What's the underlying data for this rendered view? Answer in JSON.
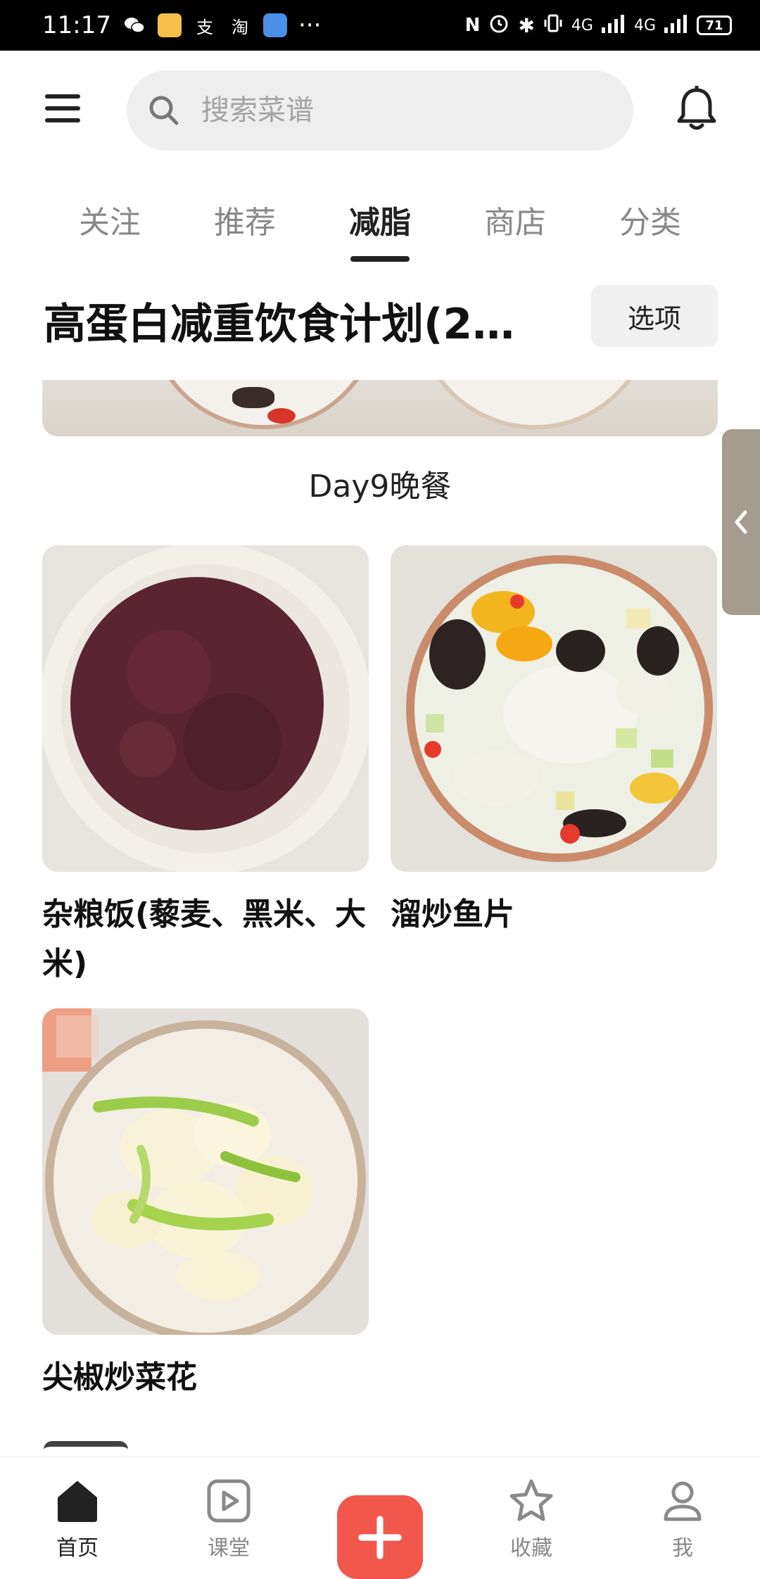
{
  "status_bar": {
    "time": "11:17",
    "alipay_glyph": "支",
    "taobao_glyph": "淘",
    "more_glyph": "···",
    "network_1": "4G",
    "network_2": "4G",
    "battery": "71"
  },
  "search": {
    "placeholder": "搜索菜谱"
  },
  "tabs": [
    {
      "label": "关注"
    },
    {
      "label": "推荐"
    },
    {
      "label": "减脂"
    },
    {
      "label": "商店"
    },
    {
      "label": "分类"
    }
  ],
  "active_tab": "减脂",
  "plan": {
    "title": "高蛋白减重饮食计划(2…",
    "options_label": "选项"
  },
  "section": {
    "title": "Day9晚餐"
  },
  "recipes": [
    {
      "name": "杂粮饭(藜麦、黑米、大米)"
    },
    {
      "name": "溜炒鱼片"
    },
    {
      "name": "尖椒炒菜花"
    }
  ],
  "bottom_nav": [
    {
      "label": "首页",
      "icon": "home-icon"
    },
    {
      "label": "课堂",
      "icon": "play-icon"
    },
    {
      "label": "",
      "icon": "add-icon"
    },
    {
      "label": "收藏",
      "icon": "star-icon"
    },
    {
      "label": "我",
      "icon": "profile-icon"
    }
  ],
  "colors": {
    "accent": "#f2574b",
    "handle": "#a59c8f"
  }
}
